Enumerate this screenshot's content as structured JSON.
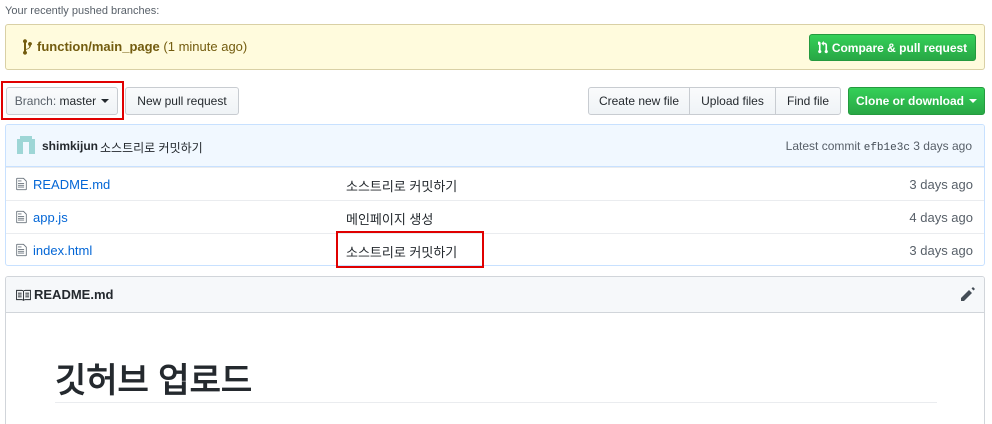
{
  "recent_branches": {
    "label": "Your recently pushed branches:",
    "branch_name": "function/main_page",
    "branch_time": "(1 minute ago)",
    "compare_label": "Compare & pull request"
  },
  "toolbar": {
    "branch_prefix": "Branch:",
    "branch_value": "master",
    "new_pr_label": "New pull request",
    "create_file_label": "Create new file",
    "upload_label": "Upload files",
    "find_label": "Find file",
    "clone_label": "Clone or download"
  },
  "commit": {
    "author": "shimkijun",
    "message": "소스트리로 커밋하기",
    "latest_label": "Latest commit",
    "sha": "efb1e3c",
    "age": "3 days ago"
  },
  "files": [
    {
      "name": "README.md",
      "message": "소스트리로 커밋하기",
      "age": "3 days ago"
    },
    {
      "name": "app.js",
      "message": "메인페이지 생성",
      "age": "4 days ago"
    },
    {
      "name": "index.html",
      "message": "소스트리로 커밋하기",
      "age": "3 days ago"
    }
  ],
  "readme": {
    "title": "README.md",
    "heading": "깃허브 업로드"
  },
  "colors": {
    "primary_green": "#28a745",
    "link_blue": "#0366d6",
    "highlight_red": "#e00000",
    "banner_yellow": "#fffbdd"
  }
}
